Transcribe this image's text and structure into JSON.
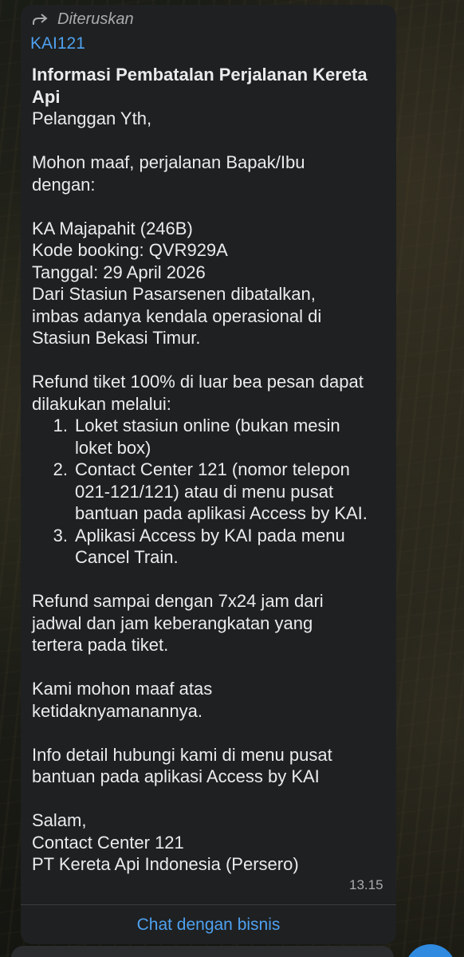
{
  "message": {
    "forwarded_label": "Diteruskan",
    "sender": "KAI121",
    "title_line1": "Informasi Pembatalan Perjalanan Kereta",
    "title_line2": "Api",
    "greeting": "Pelanggan Yth,",
    "apology_line1": "Mohon maaf, perjalanan Bapak/Ibu",
    "apology_line2": "dengan:",
    "train": "KA Majapahit (246B)",
    "booking": "Kode booking: QVR929A",
    "date": "Tanggal: 29 April 2026",
    "reason_line1": "Dari Stasiun Pasarsenen dibatalkan,",
    "reason_line2": "imbas adanya kendala operasional di",
    "reason_line3": "Stasiun Bekasi Timur.",
    "refund_line1": "Refund tiket 100% di luar bea pesan dapat",
    "refund_line2": "dilakukan melalui:",
    "list": [
      {
        "num": "1.",
        "line1": "Loket stasiun online (bukan mesin",
        "line2": "loket box)"
      },
      {
        "num": "2.",
        "line1": "Contact Center 121 (nomor telepon",
        "line2": "021-121/121) atau di menu pusat",
        "line3": "bantuan pada aplikasi Access by KAI."
      },
      {
        "num": "3.",
        "line1": "Aplikasi Access by KAI pada menu",
        "line2": "Cancel Train."
      }
    ],
    "deadline_line1": "Refund sampai dengan 7x24 jam dari",
    "deadline_line2": "jadwal dan jam keberangkatan yang",
    "deadline_line3": "tertera pada tiket.",
    "sorry_line1": "Kami mohon maaf atas",
    "sorry_line2": "ketidaknyamanannya.",
    "info_line1": "Info detail hubungi kami di menu pusat",
    "info_line2": "bantuan pada aplikasi Access by KAI",
    "closing": "Salam,",
    "sign_line1": "Contact Center 121",
    "sign_line2": "PT Kereta Api Indonesia (Persero)",
    "time": "13.15"
  },
  "actions": {
    "chat_business": "Chat dengan bisnis"
  },
  "colors": {
    "bubble": "#1f2021",
    "link": "#4ea1ef",
    "text": "#e9ebec",
    "meta": "#a9acae"
  }
}
